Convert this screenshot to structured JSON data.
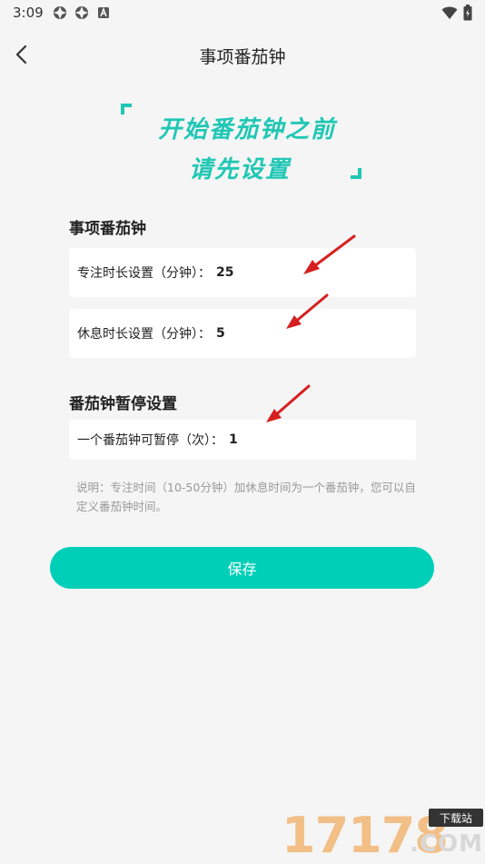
{
  "status_bar": {
    "time": "3:09",
    "left_icons": [
      "app-icon",
      "app-icon",
      "a-icon"
    ],
    "right_icons": [
      "wifi-icon",
      "battery-icon"
    ]
  },
  "nav": {
    "title": "事项番茄钟",
    "back_icon": "chevron-left-icon"
  },
  "banner": {
    "line1": "开始番茄钟之前",
    "line2": "请先设置",
    "color": "#1fc7b4"
  },
  "section1": {
    "title": "事项番茄钟",
    "rows": [
      {
        "label": "专注时长设置（分钟）：",
        "value": "25"
      },
      {
        "label": "休息时长设置（分钟）：",
        "value": "5"
      }
    ]
  },
  "section2": {
    "title": "番茄钟暂停设置",
    "rows": [
      {
        "label": "一个番茄钟可暂停（次）：",
        "value": "1"
      }
    ]
  },
  "note": "说明：专注时间（10-50分钟）加休息时间为一个番茄钟，您可以自定义番茄钟时间。",
  "save_button": {
    "label": "保存",
    "color": "#00cfb8"
  },
  "watermark": {
    "digits": "17178",
    "badge": "下载站",
    "com": ".COM"
  }
}
